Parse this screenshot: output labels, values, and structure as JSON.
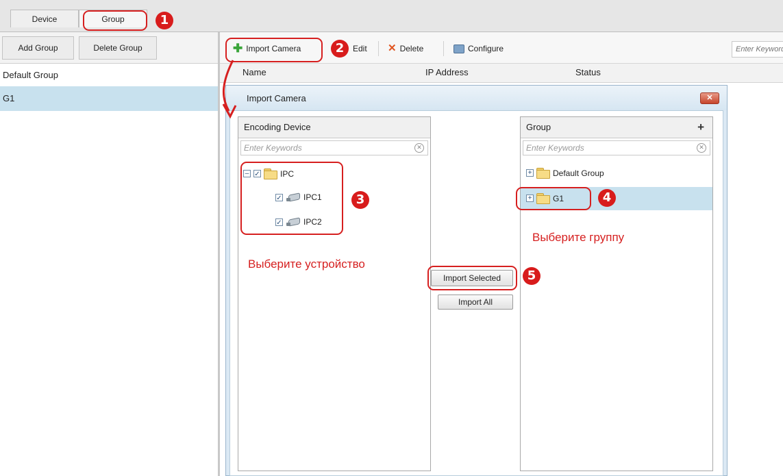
{
  "top_tabs": [
    {
      "label": "Device"
    },
    {
      "label": "Group"
    }
  ],
  "left_toolbar": {
    "add_group": "Add Group",
    "delete_group": "Delete Group"
  },
  "groups": [
    {
      "label": "Default Group"
    },
    {
      "label": "G1"
    }
  ],
  "toolbar": {
    "import_camera": "Import Camera",
    "edit": "Edit",
    "delete": "Delete",
    "configure": "Configure",
    "search_placeholder": "Enter Keywords"
  },
  "table": {
    "columns": [
      "Name",
      "IP Address",
      "Status"
    ]
  },
  "dialog": {
    "title": "Import Camera",
    "left_panel": {
      "title": "Encoding Device",
      "search_placeholder": "Enter Keywords",
      "tree": {
        "root": "IPC",
        "children": [
          "IPC1",
          "IPC2"
        ]
      }
    },
    "right_panel": {
      "title": "Group",
      "search_placeholder": "Enter Keywords",
      "items": [
        "Default Group",
        "G1"
      ]
    },
    "import_selected": "Import Selected",
    "import_all": "Import All"
  },
  "annotations": {
    "steps": [
      "1",
      "2",
      "3",
      "4",
      "5"
    ],
    "select_device": "Выберите устройство",
    "select_group": "Выберите группу"
  },
  "colors": {
    "selection": "#c8e1ee",
    "annotation_red": "#d61f1f",
    "dialog_frame": "#dbe9f4"
  }
}
